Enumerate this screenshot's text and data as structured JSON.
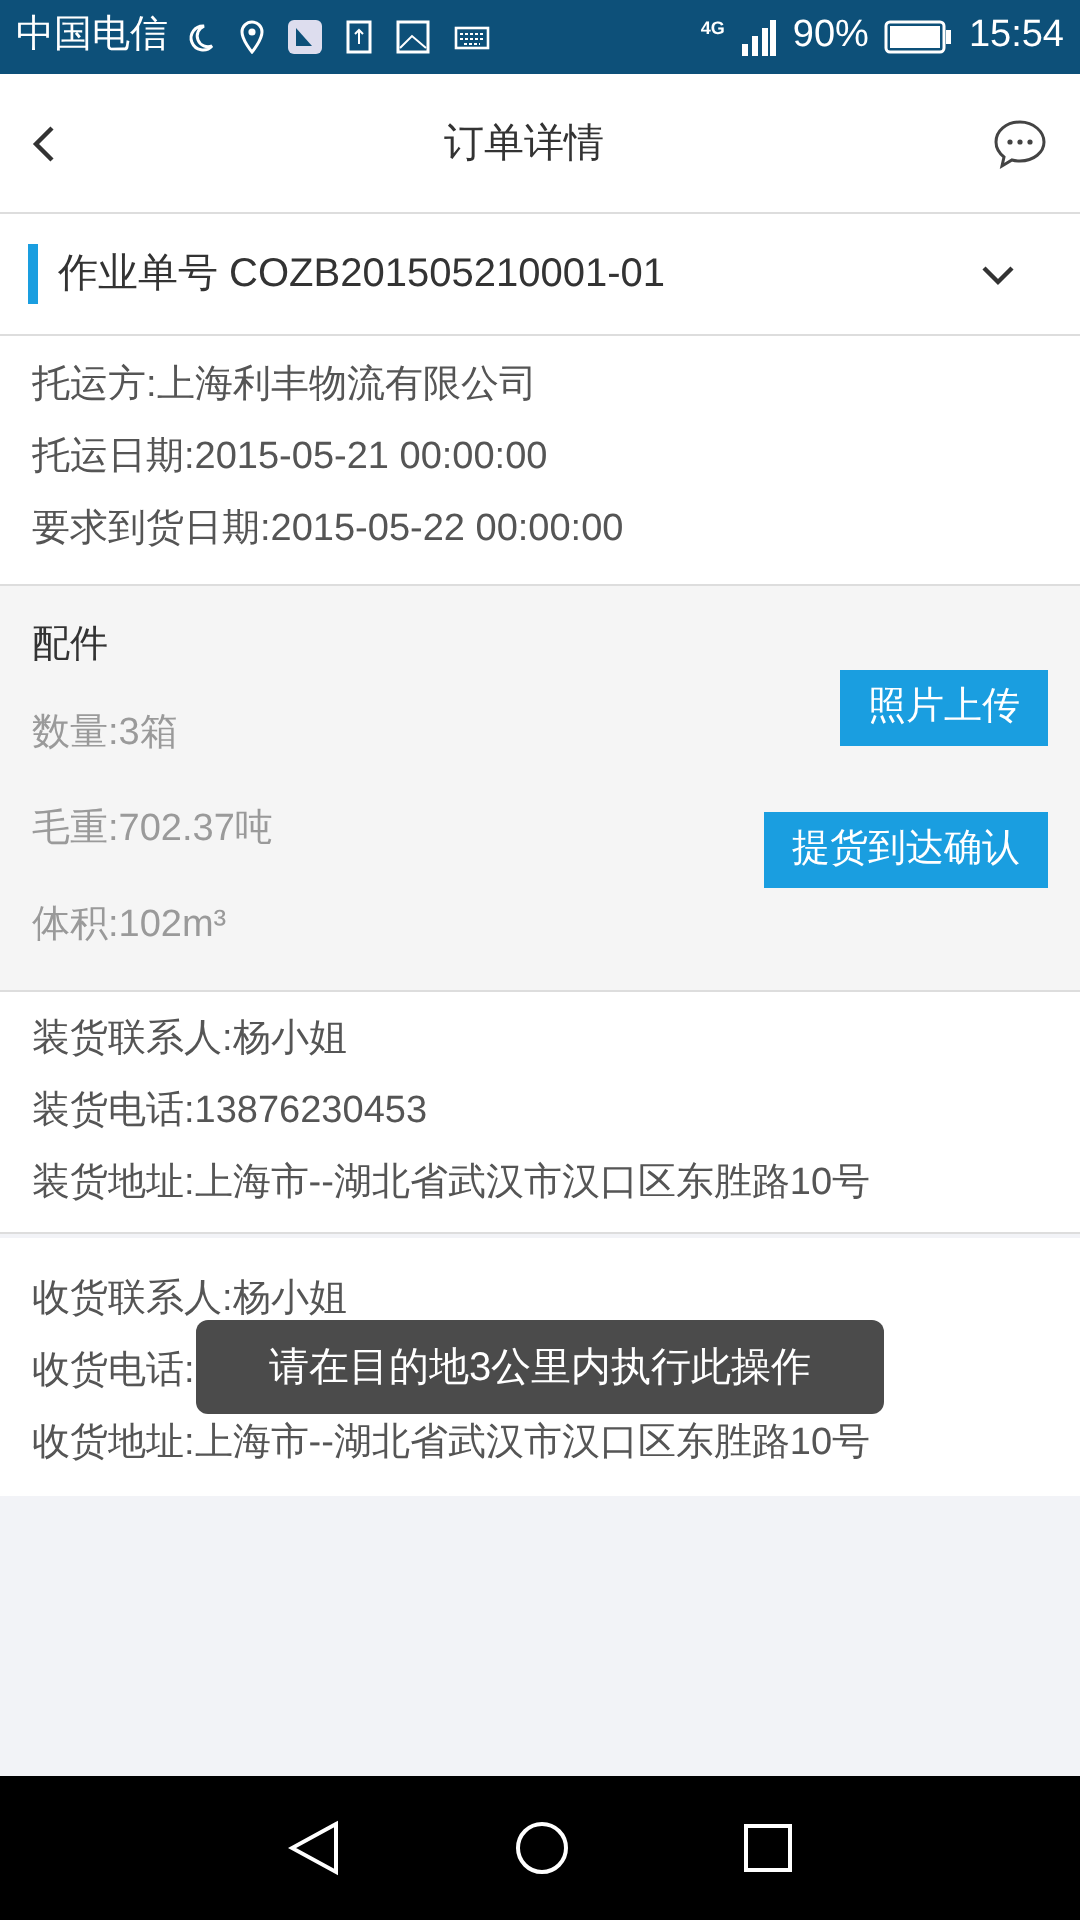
{
  "status_bar": {
    "carrier": "中国电信",
    "network": "4G",
    "battery": "90%",
    "time": "15:54"
  },
  "header": {
    "title": "订单详情"
  },
  "order": {
    "label": "作业单号 COZB201505210001-01",
    "expanded": true
  },
  "shipment": [
    "托运方:上海利丰物流有限公司",
    "托运日期:2015-05-21 00:00:00",
    "要求到货日期:2015-05-22 00:00:00"
  ],
  "parts": {
    "title": "配件",
    "lines": [
      "数量:3箱",
      "毛重:702.37吨",
      "体积:102m³"
    ],
    "buttons": [
      "照片上传",
      "提货到达确认"
    ]
  },
  "loading": [
    "装货联系人:杨小姐",
    "装货电话:13876230453",
    "装货地址:上海市--湖北省武汉市汉口区东胜路10号"
  ],
  "receiving": [
    "收货联系人:杨小姐",
    "收货电话:",
    "收货地址:上海市--湖北省武汉市汉口区东胜路10号"
  ],
  "toast": "请在目的地3公里内执行此操作"
}
